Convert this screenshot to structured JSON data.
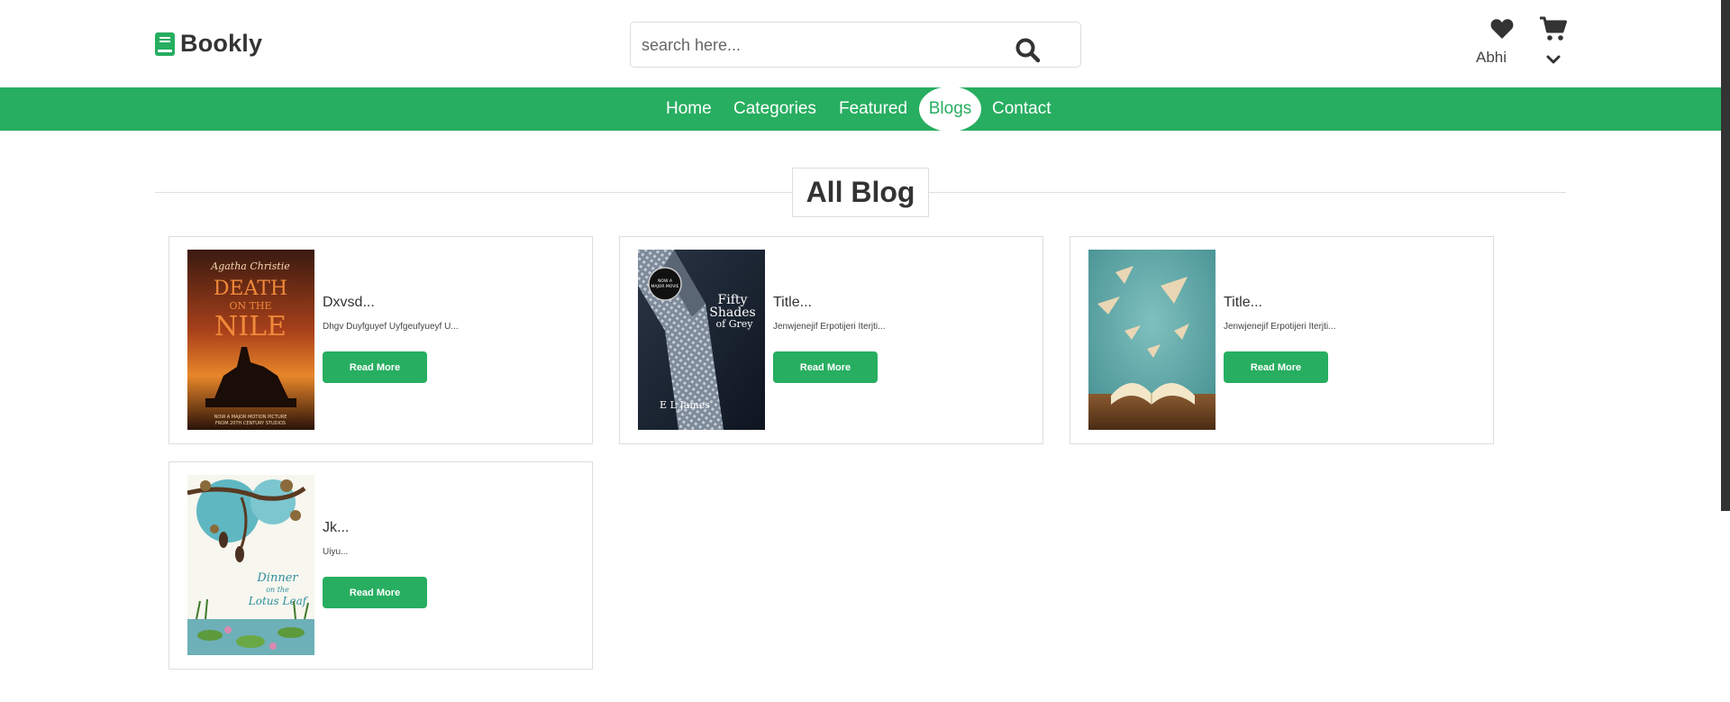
{
  "header": {
    "logo_text": "Bookly",
    "search_placeholder": "search here...",
    "user_name": "Abhi"
  },
  "nav": {
    "items": [
      {
        "label": "Home"
      },
      {
        "label": "Categories"
      },
      {
        "label": "Featured"
      },
      {
        "label": "Blogs",
        "active": true
      },
      {
        "label": "Contact"
      }
    ]
  },
  "page": {
    "heading": "All Blog"
  },
  "blogs": [
    {
      "title": "Dxvsd...",
      "excerpt": "Dhgv Duyfguyef Uyfgeufyueyf U...",
      "button": "Read More",
      "cover": "Death on the Nile book cover"
    },
    {
      "title": "Title...",
      "excerpt": "Jenwjenejif Erpotijeri Iterjti...",
      "button": "Read More",
      "cover": "Fifty Shades of Grey book cover"
    },
    {
      "title": "Title...",
      "excerpt": "Jenwjenejif Erpotijeri Iterjti...",
      "button": "Read More",
      "cover": "Open book with paper planes"
    },
    {
      "title": "Jk...",
      "excerpt": "Uiyu...",
      "button": "Read More",
      "cover": "Dinner on the Lotus Leaf book cover"
    }
  ],
  "colors": {
    "accent": "#27ae60",
    "text": "#333333",
    "border": "#dddddd"
  }
}
